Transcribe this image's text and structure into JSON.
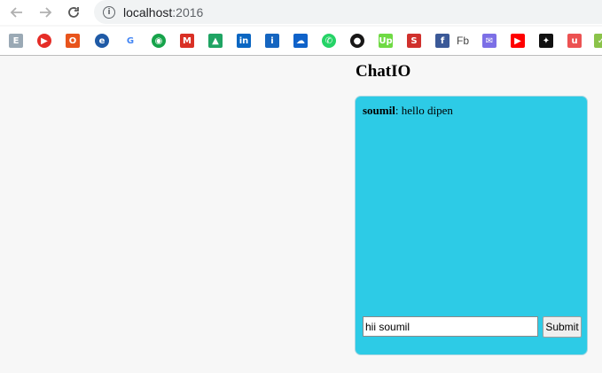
{
  "browser": {
    "url_host": "localhost",
    "url_port": ":2016",
    "bookmarks": [
      {
        "icon": "elementor-icon",
        "glyph": "E",
        "color": "#9aa9b5"
      },
      {
        "icon": "youtube-red-icon",
        "glyph": "▶",
        "color": "#e52d27"
      },
      {
        "icon": "office-icon",
        "glyph": "O",
        "color": "#e8541c"
      },
      {
        "icon": "edge-icon",
        "glyph": "e",
        "color": "#1f5aa6"
      },
      {
        "icon": "google-icon",
        "glyph": "G",
        "color": "#4285f4"
      },
      {
        "icon": "green-app-icon",
        "glyph": "◉",
        "color": "#16a34a"
      },
      {
        "icon": "gmail-icon",
        "glyph": "M",
        "color": "#d93025"
      },
      {
        "icon": "google-drive-icon",
        "glyph": "▲",
        "color": "#1fa463"
      },
      {
        "icon": "linkedin-icon",
        "glyph": "in",
        "color": "#0a66c2"
      },
      {
        "icon": "info-app-icon",
        "glyph": "i",
        "color": "#1565c0"
      },
      {
        "icon": "onedrive-icon",
        "glyph": "☁",
        "color": "#0f62c9"
      },
      {
        "icon": "whatsapp-icon",
        "glyph": "✆",
        "color": "#25d366"
      },
      {
        "icon": "github-icon",
        "glyph": "●",
        "color": "#181717"
      },
      {
        "icon": "upwork-icon",
        "glyph": "Up",
        "color": "#6fda44"
      },
      {
        "icon": "red-app-icon",
        "glyph": "S",
        "color": "#d0312d"
      },
      {
        "icon": "facebook-icon",
        "glyph": "f",
        "color": "#3b5998"
      },
      {
        "icon": "mail-icon",
        "glyph": "✉",
        "color": "#7c6fe6"
      },
      {
        "icon": "youtube-icon",
        "glyph": "▶",
        "color": "#ff0000"
      },
      {
        "icon": "star-app-icon",
        "glyph": "✦",
        "color": "#111111"
      },
      {
        "icon": "udemy-icon",
        "glyph": "u",
        "color": "#ec5252"
      },
      {
        "icon": "green-bookmark-icon",
        "glyph": "✓",
        "color": "#8bc34a"
      }
    ],
    "bookmark_fb_label": "Fb"
  },
  "app": {
    "title": "ChatIO",
    "messages": [
      {
        "sender": "soumil",
        "separator": ":",
        "text": " hello dipen"
      }
    ],
    "input_value": "hii soumil",
    "submit_label": "Submit"
  },
  "colors": {
    "chat_bg": "#2dcbe6",
    "page_bg": "#f7f7f7"
  }
}
